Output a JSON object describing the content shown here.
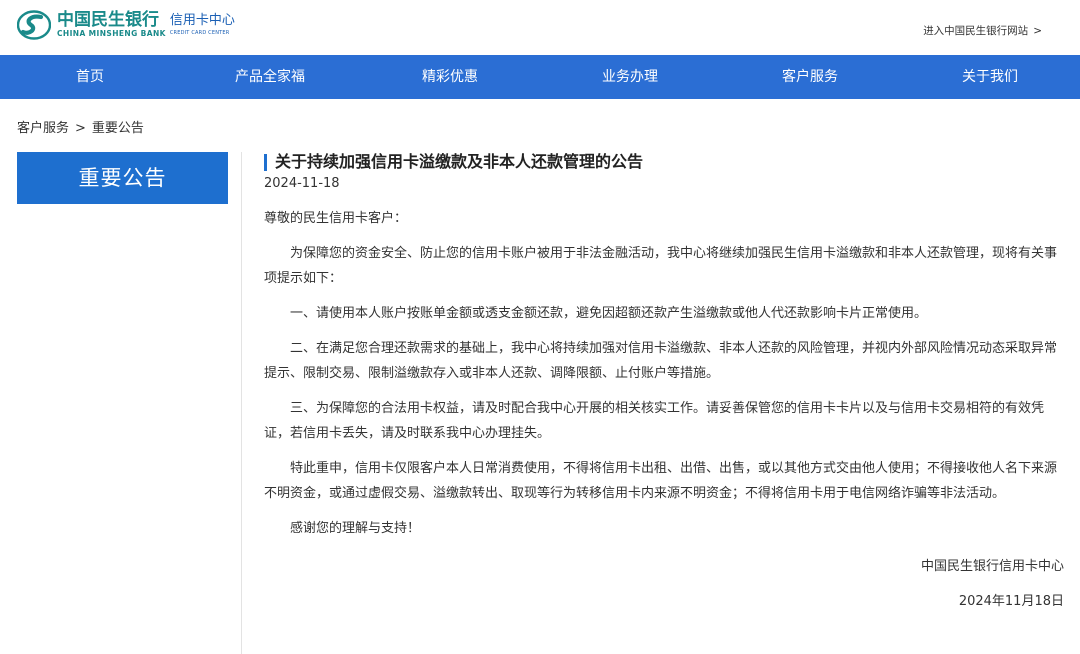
{
  "header": {
    "logo_cn": "中国民生银行",
    "logo_en": "CHINA MINSHENG BANK",
    "logo_sub_cn": "信用卡中心",
    "logo_sub_en": "CREDIT CARD CENTER",
    "site_link": "进入中国民生银行网站",
    "site_link_arrow": ">"
  },
  "nav": {
    "items": [
      "首页",
      "产品全家福",
      "精彩优惠",
      "业务办理",
      "客户服务",
      "关于我们"
    ]
  },
  "breadcrumb": {
    "parent": "客户服务",
    "separator": ">",
    "current": "重要公告"
  },
  "sidebar": {
    "title": "重要公告"
  },
  "article": {
    "title": "关于持续加强信用卡溢缴款及非本人还款管理的公告",
    "date": "2024-11-18",
    "salutation": "尊敬的民生信用卡客户：",
    "paragraphs": [
      "为保障您的资金安全、防止您的信用卡账户被用于非法金融活动，我中心将继续加强民生信用卡溢缴款和非本人还款管理，现将有关事项提示如下：",
      "一、请使用本人账户按账单金额或透支金额还款，避免因超额还款产生溢缴款或他人代还款影响卡片正常使用。",
      "二、在满足您合理还款需求的基础上，我中心将持续加强对信用卡溢缴款、非本人还款的风险管理，并视内外部风险情况动态采取异常提示、限制交易、限制溢缴款存入或非本人还款、调降限额、止付账户等措施。",
      "三、为保障您的合法用卡权益，请及时配合我中心开展的相关核实工作。请妥善保管您的信用卡卡片以及与信用卡交易相符的有效凭证，若信用卡丢失，请及时联系我中心办理挂失。",
      "特此重申，信用卡仅限客户本人日常消费使用，不得将信用卡出租、出借、出售，或以其他方式交由他人使用；不得接收他人名下来源不明资金，或通过虚假交易、溢缴款转出、取现等行为转移信用卡内来源不明资金；不得将信用卡用于电信网络诈骗等非法活动。",
      "感谢您的理解与支持！"
    ],
    "signature": "中国民生银行信用卡中心",
    "sign_date": "2024年11月18日"
  },
  "colors": {
    "nav_bg": "#2b6ed4",
    "sidebar_bg": "#1e6fcf",
    "brand_teal": "#1a8a8a",
    "brand_blue": "#1a5fb4"
  }
}
